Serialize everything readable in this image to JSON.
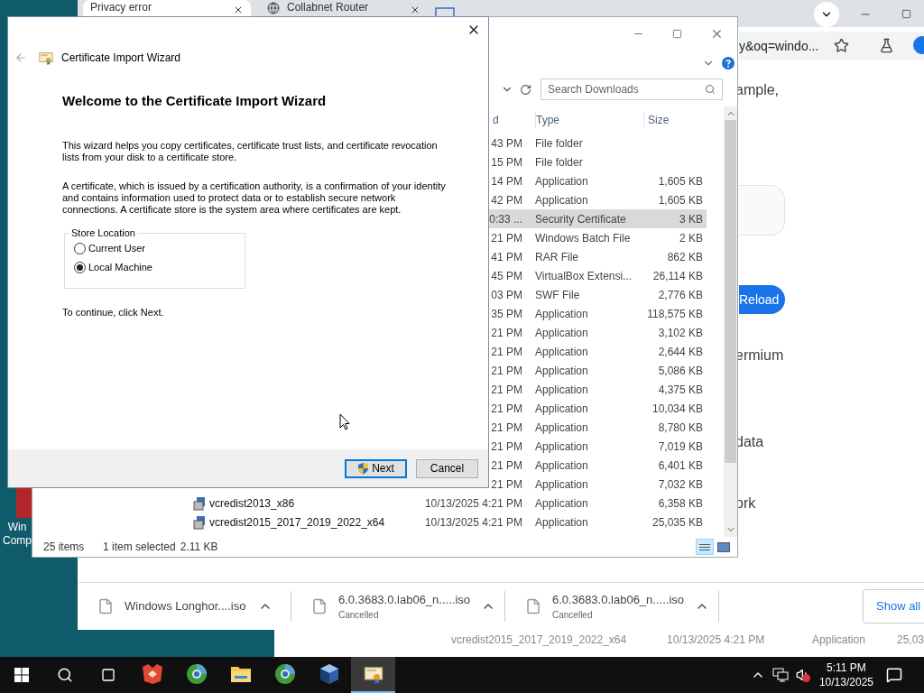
{
  "desktop": {
    "icon_label": [
      "Win",
      "Comp"
    ]
  },
  "browser": {
    "tabs": [
      {
        "title": "Privacy error",
        "selected": true
      },
      {
        "title": "Collabnet Router",
        "selected": false
      }
    ],
    "address": "y&oq=windo...",
    "page_texts": [
      {
        "kind": "line",
        "text": "ample,"
      },
      {
        "kind": "field"
      },
      {
        "kind": "button",
        "text": "Reload"
      },
      {
        "kind": "line",
        "text": "ermium"
      },
      {
        "kind": "line",
        "text": "data"
      },
      {
        "kind": "line",
        "text": "ork"
      }
    ],
    "downloads": [
      {
        "name": "Windows Longhor....iso"
      },
      {
        "name": "6.0.3683.0.lab06_n.....iso",
        "status": "Cancelled"
      },
      {
        "name": "6.0.3683.0.lab06_n.....iso",
        "status": "Cancelled"
      }
    ],
    "show_all": "Show all"
  },
  "background_window": {
    "cells": [
      "vcredist2015_2017_2019_2022_x64",
      "10/13/2025 4:21 PM",
      "Application",
      "25,03"
    ]
  },
  "explorer": {
    "search_placeholder": "Search Downloads",
    "columns": [
      "d",
      "Type",
      "Size"
    ],
    "rows": [
      {
        "date": "43 PM",
        "type": "File folder",
        "selected": false
      },
      {
        "date": "15 PM",
        "type": "File folder",
        "selected": false
      },
      {
        "date": "14 PM",
        "type": "Application",
        "size": "1,605 KB",
        "selected": false
      },
      {
        "date": "42 PM",
        "type": "Application",
        "size": "1,605 KB",
        "selected": false
      },
      {
        "date": "0:33 ...",
        "type": "Security Certificate",
        "size": "3 KB",
        "selected": true
      },
      {
        "date": "21 PM",
        "type": "Windows Batch File",
        "size": "2 KB",
        "selected": false
      },
      {
        "date": "41 PM",
        "type": "RAR File",
        "size": "862 KB",
        "selected": false
      },
      {
        "date": "45 PM",
        "type": "VirtualBox Extensi...",
        "size": "26,114 KB",
        "selected": false
      },
      {
        "date": "03 PM",
        "type": "SWF File",
        "size": "2,776 KB",
        "selected": false
      },
      {
        "date": "35 PM",
        "type": "Application",
        "size": "118,575 KB",
        "selected": false
      },
      {
        "date": "21 PM",
        "type": "Application",
        "size": "3,102 KB",
        "selected": false
      },
      {
        "date": "21 PM",
        "type": "Application",
        "size": "2,644 KB",
        "selected": false
      },
      {
        "date": "21 PM",
        "type": "Application",
        "size": "5,086 KB",
        "selected": false
      },
      {
        "date": "21 PM",
        "type": "Application",
        "size": "4,375 KB",
        "selected": false
      },
      {
        "date": "21 PM",
        "type": "Application",
        "size": "10,034 KB",
        "selected": false
      },
      {
        "date": "21 PM",
        "type": "Application",
        "size": "8,780 KB",
        "selected": false
      },
      {
        "date": "21 PM",
        "type": "Application",
        "size": "7,019 KB",
        "selected": false
      },
      {
        "date": "21 PM",
        "type": "Application",
        "size": "6,401 KB",
        "selected": false
      },
      {
        "date": "21 PM",
        "type": "Application",
        "size": "7,032 KB",
        "selected": false
      },
      {
        "name": "vcredist2013_x86",
        "date": "10/13/2025 4:21 PM",
        "type": "Application",
        "size": "6,358 KB",
        "selected": false
      },
      {
        "name": "vcredist2015_2017_2019_2022_x64",
        "date": "10/13/2025 4:21 PM",
        "type": "Application",
        "size": "25,035 KB",
        "selected": false
      }
    ],
    "status": [
      "25 items",
      "1 item selected",
      "2.11 KB"
    ]
  },
  "wizard": {
    "title": "Certificate Import Wizard",
    "heading": "Welcome to the Certificate Import Wizard",
    "paragraphs": [
      "This wizard helps you copy certificates, certificate trust lists, and certificate revocation lists from your disk to a certificate store.",
      "A certificate, which is issued by a certification authority, is a confirmation of your identity and contains information used to protect data or to establish secure network connections. A certificate store is the system area where certificates are kept."
    ],
    "group_label": "Store Location",
    "options": [
      {
        "label": "Current User",
        "selected": false
      },
      {
        "label": "Local Machine",
        "selected": true
      }
    ],
    "hint": "To continue, click Next.",
    "buttons": [
      {
        "kind": "primary",
        "label": "Next"
      },
      {
        "kind": "secondary",
        "label": "Cancel"
      }
    ]
  },
  "taskbar": {
    "apps": [
      {
        "kind": "red",
        "selected": false
      },
      {
        "kind": "globe",
        "selected": false
      },
      {
        "kind": "folder",
        "selected": false
      },
      {
        "kind": "globe",
        "selected": false
      },
      {
        "kind": "cube",
        "selected": false
      },
      {
        "kind": "certificate",
        "selected": true
      }
    ],
    "time": "5:11 PM",
    "date": "10/13/2025"
  }
}
